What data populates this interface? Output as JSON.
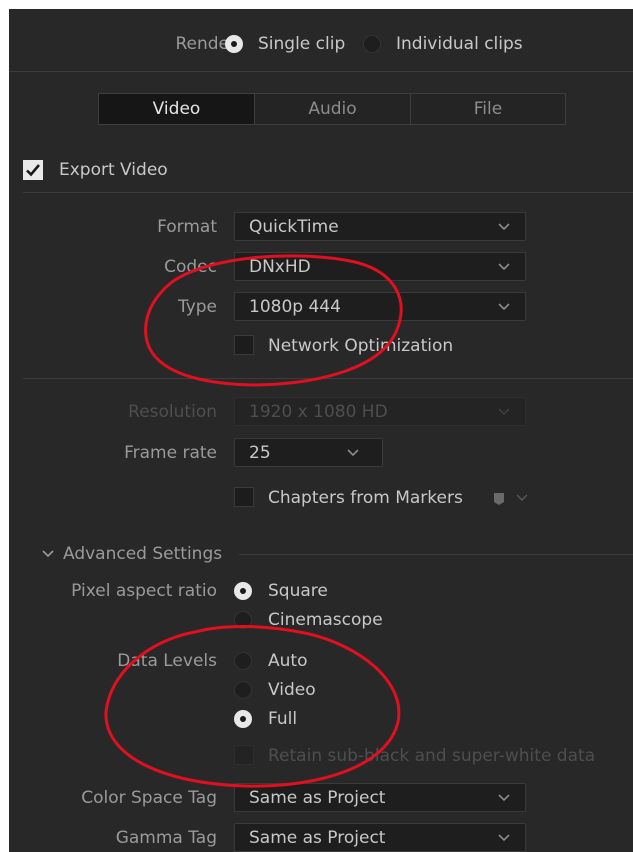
{
  "render": {
    "label": "Render",
    "options": [
      {
        "label": "Single clip",
        "selected": true
      },
      {
        "label": "Individual clips",
        "selected": false
      }
    ]
  },
  "tabs": [
    {
      "label": "Video",
      "active": true
    },
    {
      "label": "Audio",
      "active": false
    },
    {
      "label": "File",
      "active": false
    }
  ],
  "export_video": {
    "label": "Export Video",
    "checked": true
  },
  "format": {
    "label": "Format",
    "value": "QuickTime"
  },
  "codec": {
    "label": "Codec",
    "value": "DNxHD"
  },
  "type": {
    "label": "Type",
    "value": "1080p 444"
  },
  "network_optimization": {
    "label": "Network Optimization",
    "checked": false
  },
  "resolution": {
    "label": "Resolution",
    "value": "1920 x 1080 HD",
    "disabled": true
  },
  "frame_rate": {
    "label": "Frame rate",
    "value": "25"
  },
  "chapters": {
    "label": "Chapters from Markers",
    "checked": false
  },
  "advanced": {
    "label": "Advanced Settings",
    "expanded": true
  },
  "pixel_aspect": {
    "label": "Pixel aspect ratio",
    "options": [
      {
        "label": "Square",
        "selected": true
      },
      {
        "label": "Cinemascope",
        "selected": false
      }
    ]
  },
  "data_levels": {
    "label": "Data Levels",
    "options": [
      {
        "label": "Auto",
        "selected": false
      },
      {
        "label": "Video",
        "selected": false
      },
      {
        "label": "Full",
        "selected": true
      }
    ]
  },
  "retain": {
    "label": "Retain sub-black and super-white data",
    "checked": false,
    "disabled": true
  },
  "color_space_tag": {
    "label": "Color Space Tag",
    "value": "Same as Project"
  },
  "gamma_tag": {
    "label": "Gamma Tag",
    "value": "Same as Project"
  },
  "colors": {
    "panel_bg": "#282828",
    "field_bg": "#1e1e1e",
    "text": "#c8c8c8",
    "label_text": "#9a9a9a",
    "disabled_text": "#4e4e4e",
    "annotation_red": "#e01020"
  },
  "icons": {
    "dropdown": "chevron-down-icon",
    "checkbox": "checkmark-icon",
    "marker": "marker-icon",
    "section": "chevron-down-icon"
  }
}
